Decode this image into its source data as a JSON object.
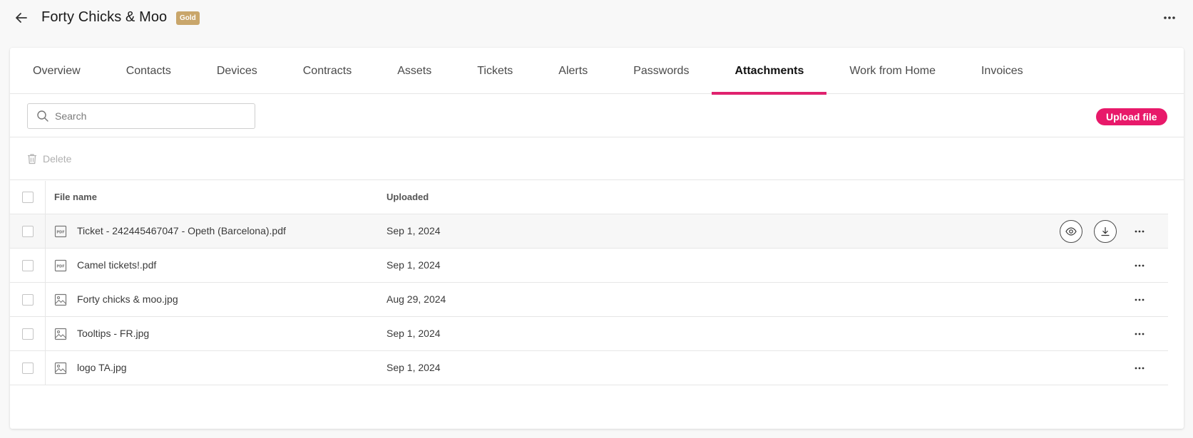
{
  "header": {
    "title": "Forty Chicks & Moo",
    "badge": "Gold",
    "badge_color": "#c9a66b"
  },
  "tabs": [
    {
      "label": "Overview",
      "active": false
    },
    {
      "label": "Contacts",
      "active": false
    },
    {
      "label": "Devices",
      "active": false
    },
    {
      "label": "Contracts",
      "active": false
    },
    {
      "label": "Assets",
      "active": false
    },
    {
      "label": "Tickets",
      "active": false
    },
    {
      "label": "Alerts",
      "active": false
    },
    {
      "label": "Passwords",
      "active": false
    },
    {
      "label": "Attachments",
      "active": true
    },
    {
      "label": "Work from Home",
      "active": false
    },
    {
      "label": "Invoices",
      "active": false
    }
  ],
  "accent_color": "#e0226e",
  "toolbar": {
    "search_placeholder": "Search",
    "upload_label": "Upload file"
  },
  "actions": {
    "delete_label": "Delete"
  },
  "table": {
    "columns": {
      "name": "File name",
      "uploaded": "Uploaded"
    },
    "rows": [
      {
        "icon": "pdf-file-icon",
        "name": "Ticket - 242445467047 - Opeth (Barcelona).pdf",
        "uploaded": "Sep 1, 2024",
        "hover": true
      },
      {
        "icon": "pdf-file-icon",
        "name": "Camel tickets!.pdf",
        "uploaded": "Sep 1, 2024",
        "hover": false
      },
      {
        "icon": "image-file-icon",
        "name": "Forty chicks & moo.jpg",
        "uploaded": "Aug 29, 2024",
        "hover": false
      },
      {
        "icon": "image-file-icon",
        "name": "Tooltips - FR.jpg",
        "uploaded": "Sep 1, 2024",
        "hover": false
      },
      {
        "icon": "image-file-icon",
        "name": "logo TA.jpg",
        "uploaded": "Sep 1, 2024",
        "hover": false
      }
    ]
  }
}
